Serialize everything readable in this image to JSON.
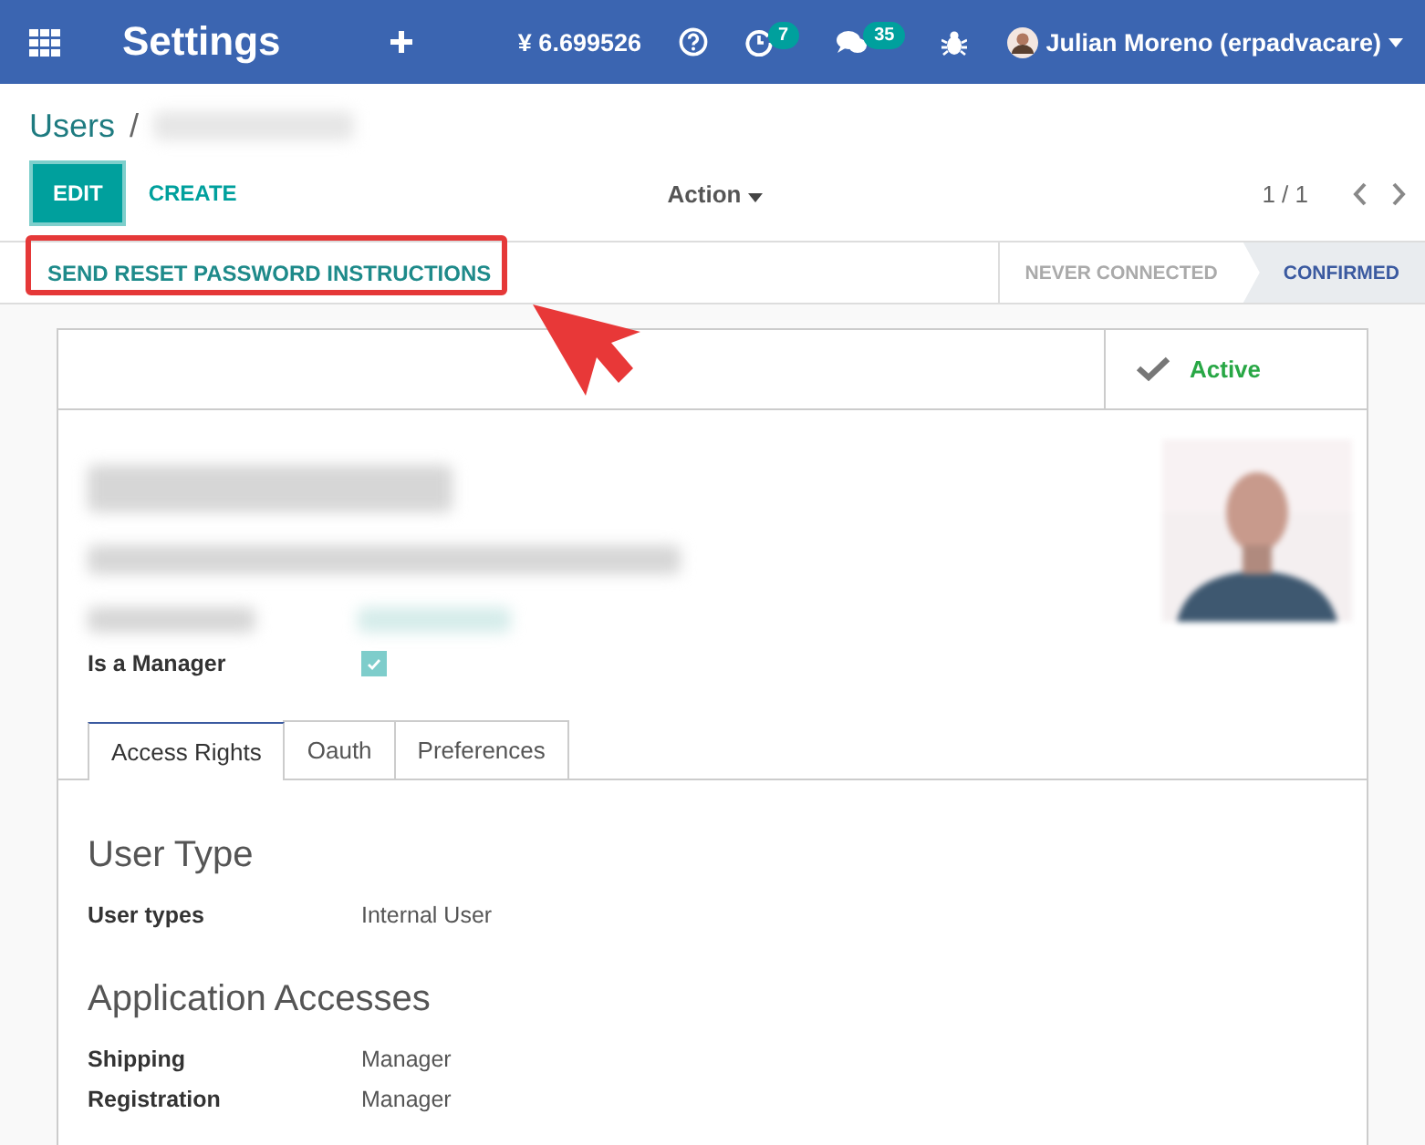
{
  "navbar": {
    "app_title": "Settings",
    "currency": "¥ 6.699526",
    "activity_count": "7",
    "messages_count": "35",
    "user": "Julian Moreno (erpadvacare)"
  },
  "breadcrumb": {
    "parent": "Users",
    "separator": "/"
  },
  "control_panel": {
    "edit": "EDIT",
    "create": "CREATE",
    "action": "Action",
    "pager": "1 / 1"
  },
  "reset_button": "SEND RESET PASSWORD INSTRUCTIONS",
  "stages": [
    {
      "label": "NEVER CONNECTED",
      "selected": false
    },
    {
      "label": "CONFIRMED",
      "selected": true
    }
  ],
  "active_toggle": {
    "label": "Active"
  },
  "is_manager": {
    "label": "Is a Manager",
    "checked": true
  },
  "tabs": [
    {
      "label": "Access Rights",
      "selected": true
    },
    {
      "label": "Oauth",
      "selected": false
    },
    {
      "label": "Preferences",
      "selected": false
    }
  ],
  "sections": [
    {
      "title": "User Type",
      "fields": [
        {
          "label": "User types",
          "value": "Internal User"
        }
      ]
    },
    {
      "title": "Application Accesses",
      "fields": [
        {
          "label": "Shipping",
          "value": "Manager"
        },
        {
          "label": "Registration",
          "value": "Manager"
        }
      ]
    }
  ]
}
